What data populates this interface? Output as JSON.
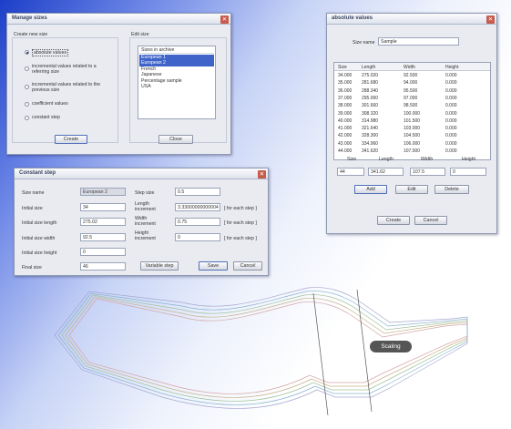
{
  "manage_sizes": {
    "title": "Manage sizes",
    "create_group": "Create new size",
    "radios": [
      "absolute values",
      "incremental values related to a referring size",
      "incremental values related to the previous size",
      "coefficient values",
      "constant step"
    ],
    "selected_radio": 0,
    "edit_group": "Edit size",
    "list": [
      "Sizes in archive",
      "European 1",
      "European 2",
      "French",
      "Japanese",
      "Percentage sample",
      "USA"
    ],
    "selected_items": [
      1,
      2
    ],
    "create_label": "Create",
    "close_label": "Close"
  },
  "constant_step": {
    "title": "Constant step",
    "size_name_label": "Size name",
    "size_name": "European 2",
    "initial_size_label": "Initial size",
    "initial_size": "34",
    "initial_length_label": "Initial size length",
    "initial_length": "275.02",
    "initial_width_label": "Initial size width",
    "initial_width": "92.5",
    "initial_height_label": "Initial size height",
    "initial_height": "0",
    "final_size_label": "Final size",
    "final_size": "46",
    "step_size_label": "Step size",
    "step_size": "0.5",
    "length_inc_label1": "Length",
    "length_inc_label2": "increment",
    "length_inc": "3.33000000000004",
    "width_inc_label1": "Width",
    "width_inc_label2": "increment",
    "width_inc": "0.75",
    "height_inc_label1": "Height",
    "height_inc_label2": "increment",
    "height_inc": "0",
    "each_step": "[ for each step ]",
    "variable_step_label": "Variable step",
    "save_label": "Save",
    "cancel_label": "Cancel"
  },
  "absolute_values": {
    "title": "absolute values",
    "size_name_label": "Size name",
    "size_name": "Sample",
    "columns": [
      "Size",
      "Length",
      "Width",
      "Height"
    ],
    "rows": [
      [
        "34.000",
        "275.020",
        "92.500",
        "0.000"
      ],
      [
        "35.000",
        "281.680",
        "94.000",
        "0.000"
      ],
      [
        "36.000",
        "288.340",
        "95.500",
        "0.000"
      ],
      [
        "37.000",
        "295.000",
        "97.000",
        "0.000"
      ],
      [
        "38.000",
        "301.660",
        "98.500",
        "0.000"
      ],
      [
        "39.000",
        "308.320",
        "100.000",
        "0.000"
      ],
      [
        "40.000",
        "314.980",
        "101.500",
        "0.000"
      ],
      [
        "41.000",
        "321.640",
        "103.000",
        "0.000"
      ],
      [
        "42.000",
        "328.300",
        "104.500",
        "0.000"
      ],
      [
        "43.000",
        "334.960",
        "106.000",
        "0.000"
      ],
      [
        "44.000",
        "341.620",
        "107.500",
        "0.000"
      ]
    ],
    "input_labels": [
      "Size",
      "Length",
      "Width",
      "Height"
    ],
    "inputs": [
      "44",
      "341.62",
      "107.5",
      "0"
    ],
    "add_label": "Add",
    "edit_label": "Edit",
    "delete_label": "Delete",
    "create_label": "Create",
    "cancel_label": "Cancel"
  },
  "scaling_badge": "Scaling",
  "colors": {
    "desktop_blue": "#1c3ec8",
    "title_text": "#3b4562",
    "close_red": "#c75b4c",
    "selection": "#3f63c8",
    "badge": "#555555"
  }
}
